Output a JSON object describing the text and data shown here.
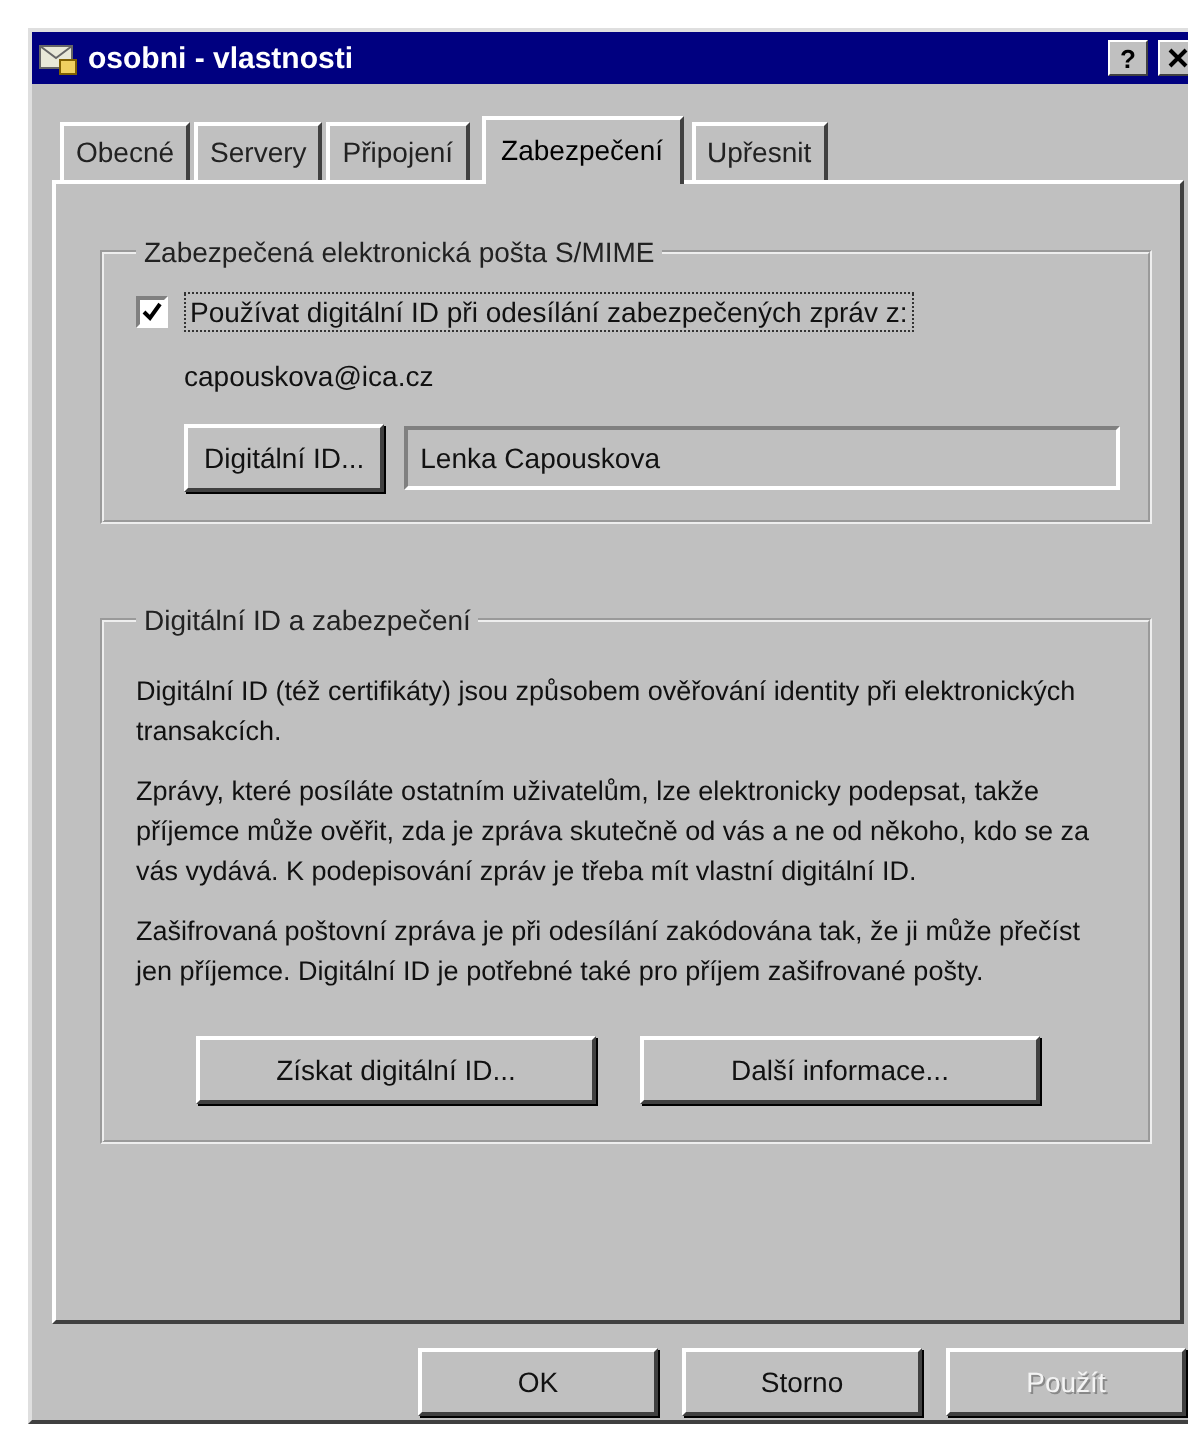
{
  "window": {
    "title": "osobni - vlastnosti",
    "help_button": "?"
  },
  "tabs": [
    {
      "label": "Obecné",
      "selected": false
    },
    {
      "label": "Servery",
      "selected": false
    },
    {
      "label": "Připojení",
      "selected": false
    },
    {
      "label": "Zabezpečení",
      "selected": true
    },
    {
      "label": "Upřesnit",
      "selected": false
    }
  ],
  "secure_mail": {
    "legend": "Zabezpečená elektronická pošta S/MIME",
    "checkbox": {
      "label": "Používat digitální ID při odesílání zabezpečených zpráv z:",
      "checked": true
    },
    "email": "capouskova@ica.cz",
    "digital_id_button": "Digitální ID...",
    "certificate_field": {
      "value": "Lenka Capouskova"
    }
  },
  "digital_id": {
    "legend": "Digitální ID a zabezpečení",
    "paragraphs": [
      "Digitální ID (též certifikáty) jsou způsobem ověřování identity při elektronických transakcích.",
      "Zprávy, které posíláte ostatním uživatelům, lze elektronicky podepsat, takže příjemce může ověřit, zda je zpráva skutečně od vás a ne od někoho, kdo se za vás vydává. K podepisování zpráv je třeba mít vlastní digitální ID.",
      "Zašifrovaná poštovní zpráva je při odesílání zakódována tak, že ji může přečíst jen příjemce. Digitální ID je potřebné také pro příjem zašifrované pošty."
    ],
    "buttons": [
      "Získat digitální ID...",
      "Další informace..."
    ]
  },
  "footer_buttons": [
    {
      "label": "OK",
      "disabled": false
    },
    {
      "label": "Storno",
      "disabled": false
    },
    {
      "label": "Použít",
      "disabled": true
    }
  ]
}
